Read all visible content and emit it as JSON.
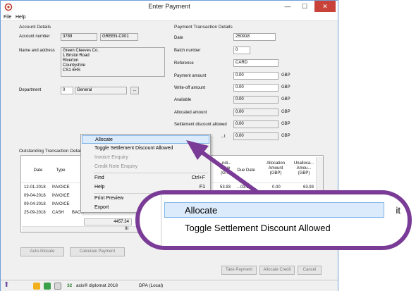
{
  "window": {
    "title": "Enter Payment",
    "minimize": "—",
    "maximize": "☐",
    "close": "✕"
  },
  "menu": [
    "File",
    "Help"
  ],
  "account": {
    "section_title": "Account Details",
    "account_number_label": "Account number",
    "account_number": "3789",
    "account_ref": "GREEN-C001",
    "name_address_label": "Name and address",
    "address_lines": [
      "Green Cleeves Co.",
      "1 Bristol Road",
      "Riverton",
      "Countyshire",
      "CS1 6HS"
    ],
    "department_label": "Department",
    "department_number": "0",
    "department_name": "General",
    "department_browse": "..."
  },
  "payment": {
    "section_title": "Payment Transaction Details",
    "date_label": "Date",
    "date": "250918",
    "batch_label": "Batch number",
    "batch": "0",
    "reference_label": "Reference",
    "reference": "CARD",
    "payment_amount_label": "Payment amount",
    "payment_amount": "0.00",
    "writeoff_label": "Write-off amount",
    "writeoff": "0.00",
    "available_label": "Available",
    "available": "0.00",
    "allocated_label": "Allocated amount",
    "allocated": "0.00",
    "settlement_label": "Settlement discount allowed",
    "settlement": "0.00",
    "last_row_label": "...t",
    "last_row_value": "0.00",
    "currency": "GBP"
  },
  "outstanding": {
    "section_title": "Outstanding Transaction Detai...",
    "headers": {
      "date": "Date",
      "type": "Type",
      "outstanding_value": "...ndi...\nValue\n(G...",
      "due_date": "Due Date",
      "allocation_amount": "Allocation\nAmount\n(GBP)",
      "unallocated": "Unalloca...\nAmou...\n(GBP)"
    },
    "rows": [
      {
        "date": "12-01-2018",
        "type": "INVOICE",
        "value": "53.93",
        "due": "...03-2...",
        "alloc": "0.00",
        "unalloc": "63.93"
      },
      {
        "date": "09-04-2018",
        "type": "INVOICE",
        "value": "",
        "due": "",
        "alloc": "",
        "unalloc": ""
      },
      {
        "date": "09-04-2018",
        "type": "INVOICE",
        "value": "",
        "due": "",
        "alloc": "",
        "unalloc": ""
      },
      {
        "date": "25-09-2018",
        "type": "CASH",
        "value": "",
        "due": "",
        "alloc": "",
        "unalloc": ""
      }
    ],
    "cash_ref_fragment": "BAC...",
    "total": "4457.34",
    "scroll_mark": "III"
  },
  "buttons": {
    "auto_allocate": "Auto Allocate",
    "calculate_payment": "Calculate Payment",
    "take_payment": "Take Payment",
    "allocate_credit": "Allocate Credit",
    "cancel": "Cancel"
  },
  "statusbar": {
    "count": "32",
    "product": "axis® diplomat 2018",
    "mode": "DPA (Local)"
  },
  "context_menu": {
    "items": [
      {
        "label": "Allocate",
        "state": "highlighted"
      },
      {
        "label": "Toggle Settlement Discount Allowed",
        "state": "enabled"
      },
      {
        "label": "Invoice Enquiry",
        "state": "disabled"
      },
      {
        "label": "Credit Note Enquiry",
        "state": "disabled"
      },
      {
        "label": "Find",
        "shortcut": "Ctrl+F",
        "state": "enabled"
      },
      {
        "label": "Help",
        "shortcut": "F1",
        "state": "enabled"
      },
      {
        "label": "Print Preview",
        "state": "enabled"
      },
      {
        "label": "Export",
        "state": "enabled"
      }
    ]
  },
  "callout": {
    "line1": "Allocate",
    "line2": "Toggle Settlement Discount Allowed",
    "fragment": "it",
    "color": "#7a3b96"
  }
}
